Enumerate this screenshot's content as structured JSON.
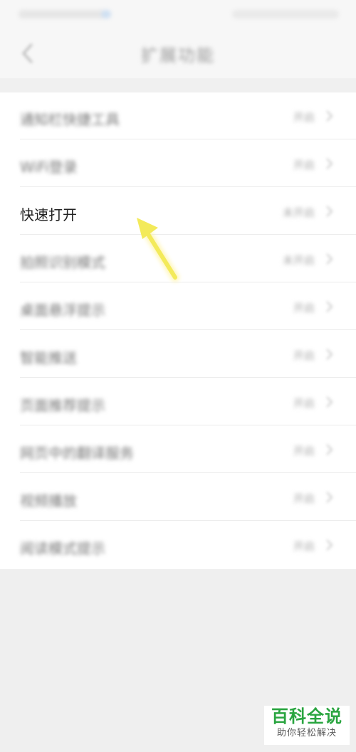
{
  "header": {
    "title": "扩展功能"
  },
  "list": {
    "items": [
      {
        "label": "通知栏快捷工具",
        "value": "开启"
      },
      {
        "label": "WiFi登录",
        "value": "开启"
      },
      {
        "label": "快速打开",
        "value": "未开启"
      },
      {
        "label": "拍照识别模式",
        "value": "未开启"
      },
      {
        "label": "桌面悬浮提示",
        "value": "开启"
      },
      {
        "label": "智能推送",
        "value": "开启"
      },
      {
        "label": "页面推荐提示",
        "value": "开启"
      },
      {
        "label": "网页中的翻译服务",
        "value": "开启"
      },
      {
        "label": "视频播放",
        "value": "开启"
      },
      {
        "label": "阅读模式提示",
        "value": "开启"
      }
    ]
  },
  "watermark": {
    "title": "百科全说",
    "subtitle": "助你轻松解决"
  },
  "colors": {
    "arrow": "#f3ea5a",
    "watermark_green": "#2aa540",
    "background": "#efefef"
  },
  "icons": [
    "back-arrow-icon",
    "chevron-right-icon",
    "pointer-arrow-icon"
  ]
}
